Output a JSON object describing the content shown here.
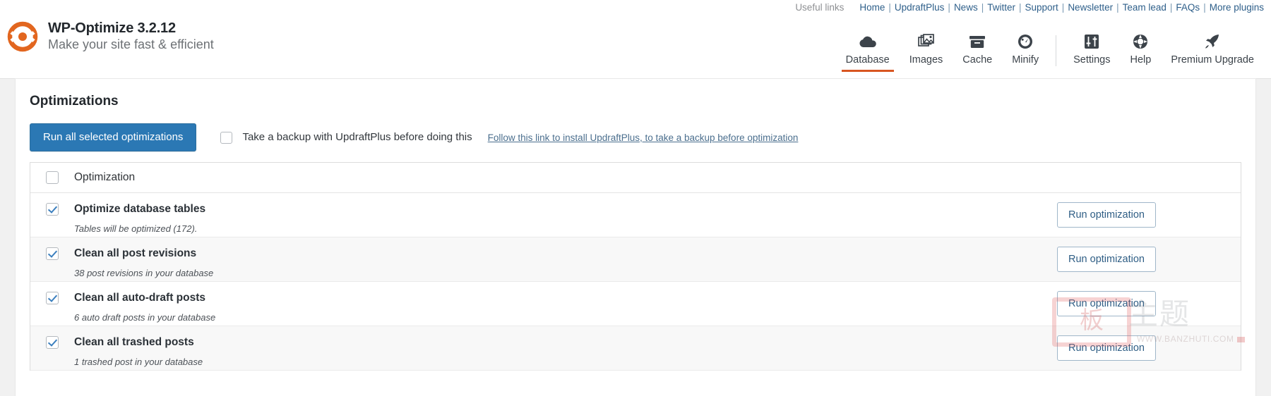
{
  "header": {
    "useful_links_label": "Useful links",
    "links": [
      {
        "label": "Home"
      },
      {
        "label": "UpdraftPlus"
      },
      {
        "label": "News"
      },
      {
        "label": "Twitter"
      },
      {
        "label": "Support"
      },
      {
        "label": "Newsletter"
      },
      {
        "label": "Team lead"
      },
      {
        "label": "FAQs"
      },
      {
        "label": "More plugins"
      }
    ],
    "separator": "|",
    "brand": {
      "title": "WP-Optimize 3.2.12",
      "subtitle": "Make your site fast & efficient",
      "logo_icon": "wp-optimize-logo-icon"
    },
    "nav": [
      {
        "label": "Database",
        "icon": "cloud-icon",
        "active": true
      },
      {
        "label": "Images",
        "icon": "images-icon",
        "active": false
      },
      {
        "label": "Cache",
        "icon": "archive-box-icon",
        "active": false
      },
      {
        "label": "Minify",
        "icon": "speedometer-icon",
        "active": false
      },
      {
        "label": "Settings",
        "icon": "sliders-icon",
        "active": false
      },
      {
        "label": "Help",
        "icon": "life-ring-icon",
        "active": false
      },
      {
        "label": "Premium Upgrade",
        "icon": "rocket-icon",
        "active": false
      }
    ],
    "accent_color": "#d85621"
  },
  "main": {
    "section_title": "Optimizations",
    "run_all_label": "Run all selected optimizations",
    "backup_text": "Take a backup with UpdraftPlus before doing this",
    "backup_link": "Follow this link to install UpdraftPlus, to take a backup before optimization",
    "backup_checkbox_checked": false,
    "table": {
      "header_checkbox_checked": false,
      "column_header": "Optimization",
      "action_label": "Run optimization",
      "rows": [
        {
          "checked": true,
          "title": "Optimize database tables",
          "description": "Tables will be optimized (172).",
          "action": "Run optimization"
        },
        {
          "checked": true,
          "title": "Clean all post revisions",
          "description": "38 post revisions in your database",
          "action": "Run optimization"
        },
        {
          "checked": true,
          "title": "Clean all auto-draft posts",
          "description": "6 auto draft posts in your database",
          "action": "Run optimization"
        },
        {
          "checked": true,
          "title": "Clean all trashed posts",
          "description": "1 trashed post in your database",
          "action": "Run optimization"
        }
      ]
    },
    "primary_button_color": "#2b78b4",
    "secondary_button_text_color": "#2f5e85"
  },
  "watermark": {
    "stamp_char": "板",
    "characters": "主题",
    "url": "WWW.BANZHUTI.COM"
  }
}
